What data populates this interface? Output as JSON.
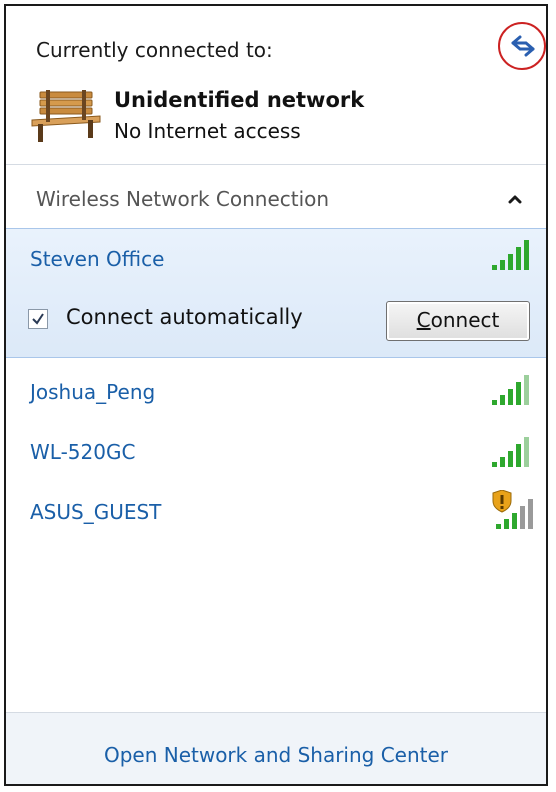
{
  "header": {
    "title": "Currently connected to:",
    "network_name": "Unidentified network",
    "network_status": "No Internet access"
  },
  "section": {
    "label": "Wireless Network Connection",
    "collapse_icon": "chevron-up-icon"
  },
  "selected_network": {
    "name": "Steven Office",
    "signal_icon": "signal-strength-icon",
    "auto_connect_label": "Connect automatically",
    "auto_connect_checked": true,
    "connect_button_first": "C",
    "connect_button_rest": "onnect"
  },
  "networks": [
    {
      "name": "Joshua_Peng",
      "signal_icon": "signal-strength-icon"
    },
    {
      "name": "WL-520GC",
      "signal_icon": "signal-strength-icon"
    },
    {
      "name": "ASUS_GUEST",
      "signal_icon": "unsecured-signal-shield-icon"
    }
  ],
  "footer": {
    "link": "Open Network and Sharing Center"
  },
  "colors": {
    "link_blue": "#1a5fa8",
    "signal_green": "#2ea82e",
    "highlight_bg": "#dce9f8",
    "refresh_circle": "#cc2222"
  }
}
